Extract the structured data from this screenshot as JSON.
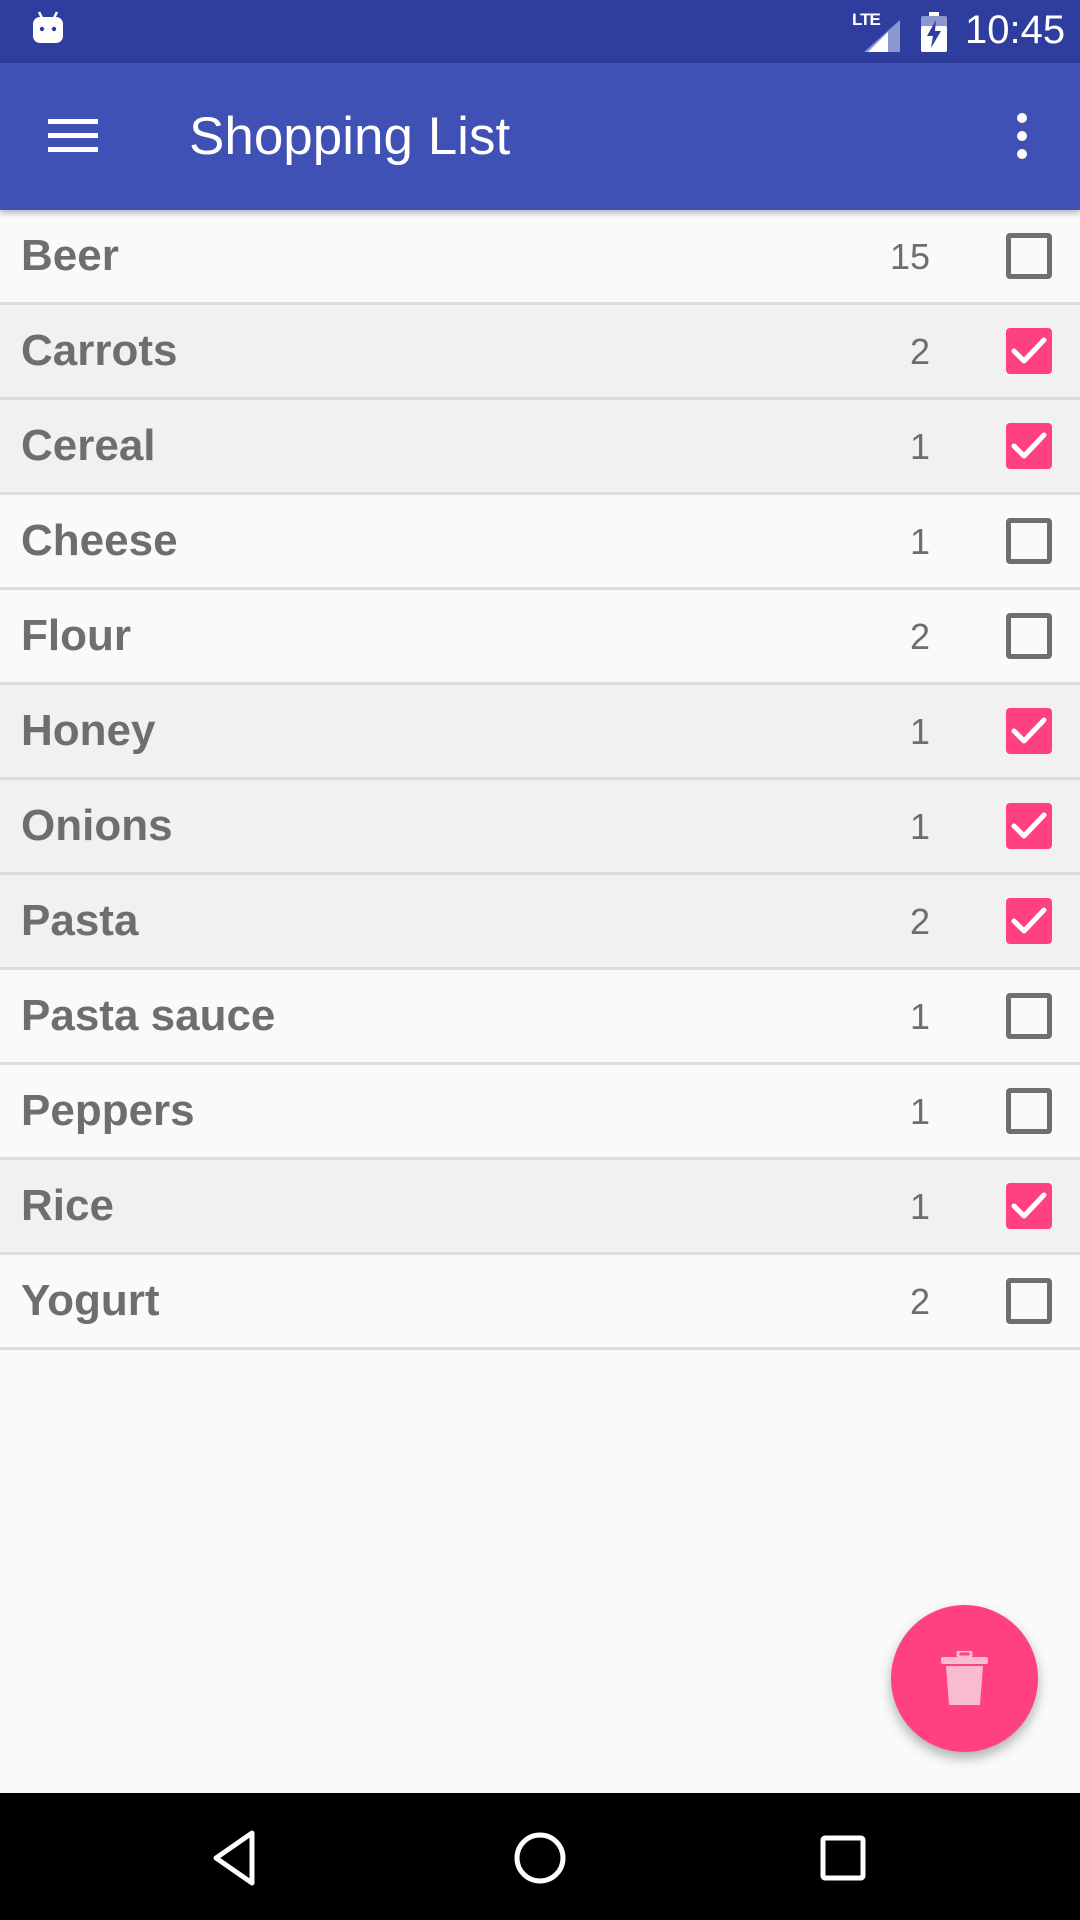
{
  "status_bar": {
    "network_label": "LTE",
    "time": "10:45",
    "icons": [
      "android-icon",
      "signal-icon",
      "battery-icon"
    ]
  },
  "toolbar": {
    "title": "Shopping List",
    "icons": [
      "menu-icon",
      "overflow-menu-icon"
    ]
  },
  "items": [
    {
      "name": "Beer",
      "quantity": "15",
      "checked": false
    },
    {
      "name": "Carrots",
      "quantity": "2",
      "checked": true
    },
    {
      "name": "Cereal",
      "quantity": "1",
      "checked": true
    },
    {
      "name": "Cheese",
      "quantity": "1",
      "checked": false
    },
    {
      "name": "Flour",
      "quantity": "2",
      "checked": false
    },
    {
      "name": "Honey",
      "quantity": "1",
      "checked": true
    },
    {
      "name": "Onions",
      "quantity": "1",
      "checked": true
    },
    {
      "name": "Pasta",
      "quantity": "2",
      "checked": true
    },
    {
      "name": "Pasta sauce",
      "quantity": "1",
      "checked": false
    },
    {
      "name": "Peppers",
      "quantity": "1",
      "checked": false
    },
    {
      "name": "Rice",
      "quantity": "1",
      "checked": true
    },
    {
      "name": "Yogurt",
      "quantity": "2",
      "checked": false
    }
  ],
  "fab": {
    "icon": "delete-icon"
  },
  "nav_bar": {
    "icons": [
      "back-icon",
      "home-icon",
      "recents-icon"
    ]
  },
  "colors": {
    "status_bar": "#2f3e9e",
    "primary": "#3f51b5",
    "accent": "#ff4081",
    "text": "#6e6e6e",
    "checked_row": "#f1f1f1",
    "background": "#fafafa"
  }
}
